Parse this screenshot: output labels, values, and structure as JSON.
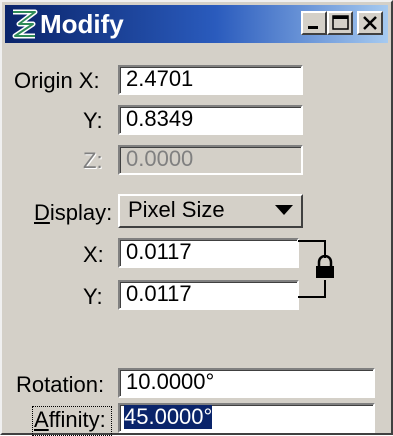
{
  "window": {
    "title": "Modify",
    "controls": [
      "minimize-icon",
      "maximize-icon",
      "close-icon"
    ]
  },
  "origin": {
    "x_label_prefix": "",
    "x_label": "Origin X:",
    "x_value": "2.4701",
    "y_label": "Y:",
    "y_value": "0.8349",
    "z_label": "Z:",
    "z_value": "0.0000"
  },
  "display": {
    "label_mnemonic": "D",
    "label_rest": "isplay:",
    "selected": "Pixel Size",
    "x_label": "X:",
    "x_value": "0.0117",
    "y_label": "Y:",
    "y_value": "0.0117"
  },
  "rotation": {
    "label": "Rotation:",
    "value": "10.0000°"
  },
  "affinity": {
    "label_mnemonic": "A",
    "label_rest": "ffinity:",
    "value": "45.0000°"
  },
  "colors": {
    "title_gradient_start": "#0a246a",
    "title_gradient_end": "#a6caf0",
    "face": "#d4d0c8",
    "selection": "#0a246a"
  }
}
